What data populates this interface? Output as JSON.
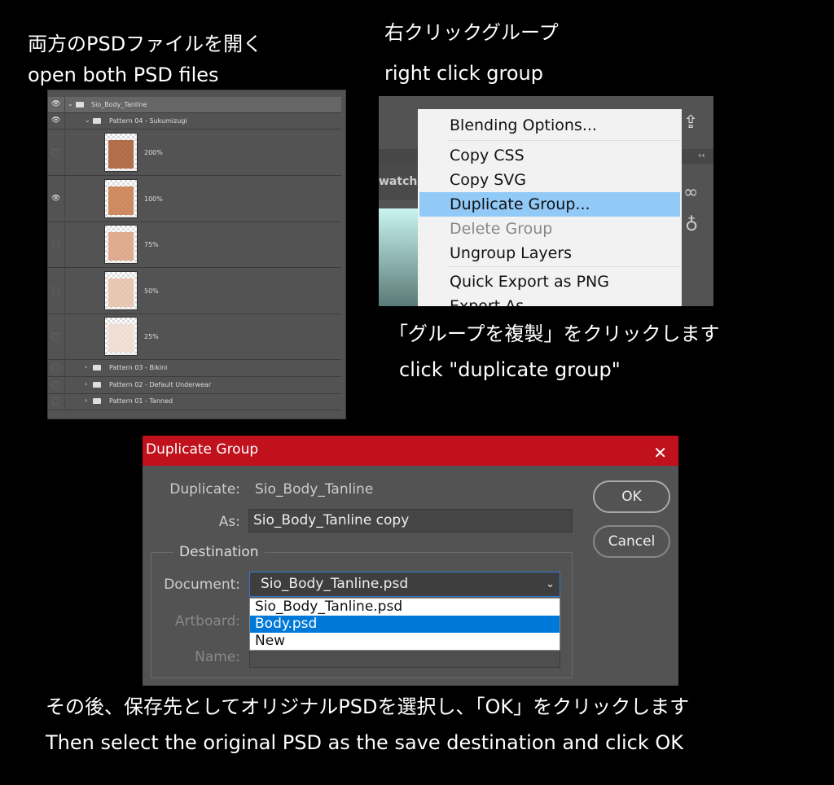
{
  "captions": {
    "open_jp": "両方のPSDファイルを開く",
    "open_en": "open both PSD files",
    "right_jp": "右クリックグループ",
    "right_en": "right click group",
    "dup_jp": "「グループを複製」をクリックします",
    "dup_en": "click \"duplicate group\"",
    "save_jp": "その後、保存先としてオリジナルPSDを選択し、「OK」をクリックします",
    "save_en": "Then select the original PSD as the save destination and click OK"
  },
  "layers": {
    "group": "Sio_Body_Tanline",
    "subgroup": "Pattern 04 - Sukumizugi",
    "items": [
      {
        "label": "200%",
        "visible": false
      },
      {
        "label": "100%",
        "visible": true
      },
      {
        "label": "75%",
        "visible": false
      },
      {
        "label": "50%",
        "visible": false
      },
      {
        "label": "25%",
        "visible": false
      }
    ],
    "folders": [
      "Pattern 03 - Bikini",
      "Pattern 02 - Default Underwear",
      "Pattern 01 - Tanned"
    ]
  },
  "context_menu": {
    "panel_tab": "watche",
    "items": [
      "Blending Options...",
      "Copy CSS",
      "Copy SVG",
      "Duplicate Group...",
      "Delete Group",
      "Ungroup Layers",
      "Quick Export as PNG",
      "Export As..."
    ],
    "highlighted": "Duplicate Group...",
    "disabled": "Delete Group"
  },
  "dialog": {
    "title": "Duplicate Group",
    "close": "✕",
    "duplicate_label": "Duplicate:",
    "duplicate_value": "Sio_Body_Tanline",
    "as_label": "As:",
    "as_value": "Sio_Body_Tanline copy",
    "destination_label": "Destination",
    "document_label": "Document:",
    "document_value": "Sio_Body_Tanline.psd",
    "artboard_label": "Artboard:",
    "name_label": "Name:",
    "options": [
      "Sio_Body_Tanline.psd",
      "Body.psd",
      "New"
    ],
    "ok": "OK",
    "cancel": "Cancel",
    "accent": "#0078d7"
  }
}
